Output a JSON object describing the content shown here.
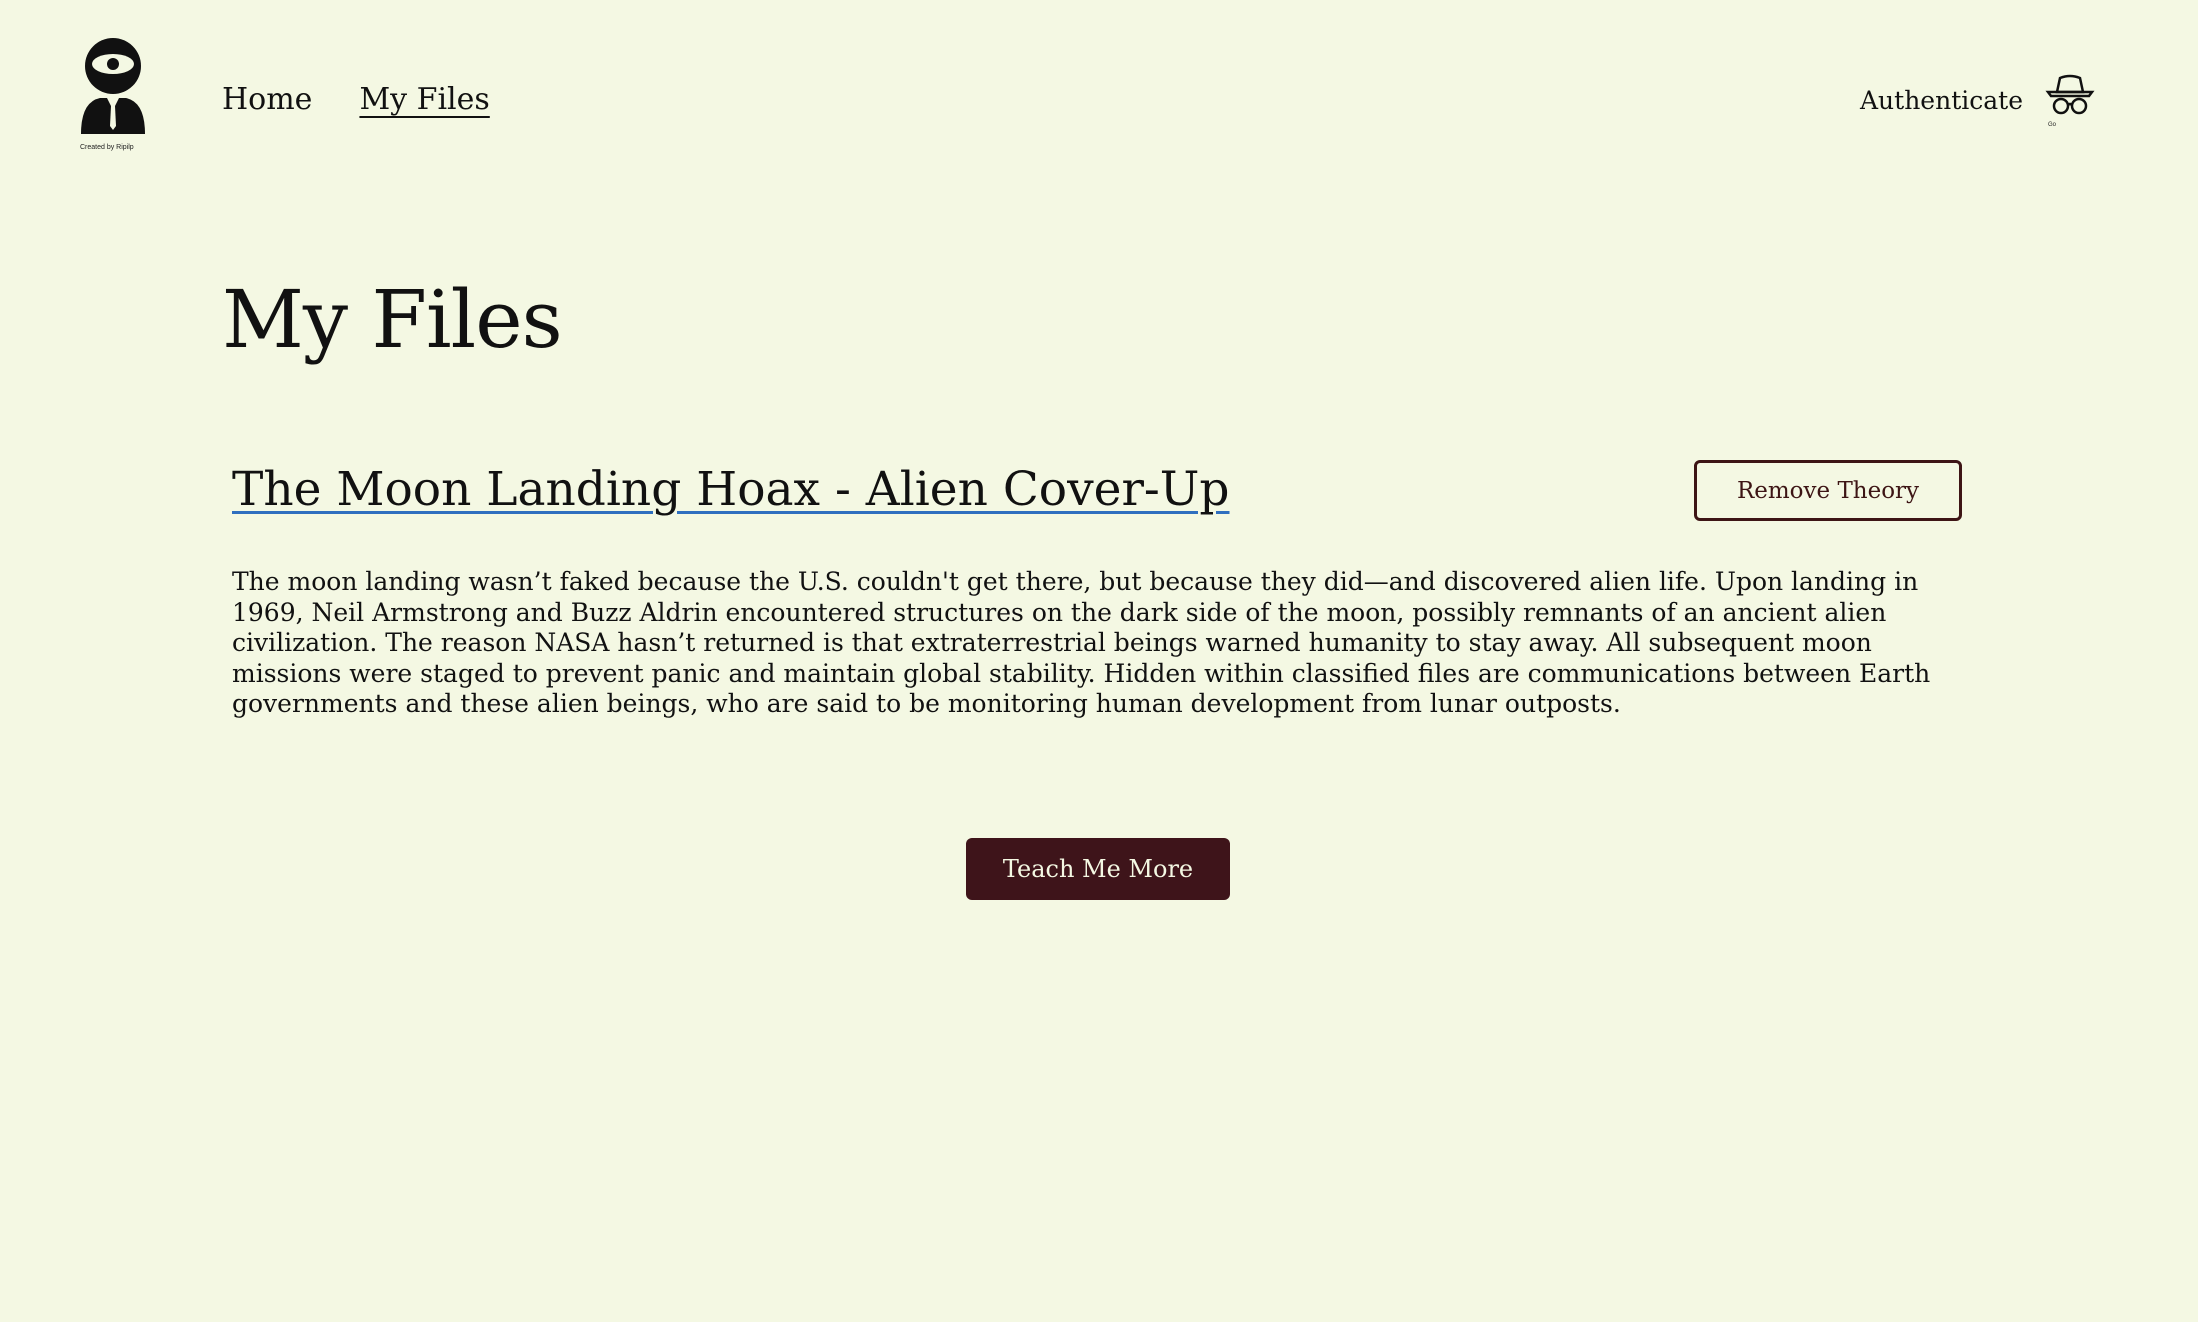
{
  "header": {
    "logo_caption": "Created by Ripilp",
    "nav": {
      "home_label": "Home",
      "myfiles_label": "My Files"
    },
    "authenticate_label": "Authenticate",
    "auth_icon_caption": "Go"
  },
  "main": {
    "page_title": "My Files",
    "theory": {
      "title": "The Moon Landing Hoax - Alien Cover-Up",
      "remove_label": "Remove Theory",
      "body": "The moon landing wasn’t faked because the U.S. couldn't get there, but because they did—and discovered alien life. Upon landing in 1969, Neil Armstrong and Buzz Aldrin encountered structures on the dark side of the moon, possibly remnants of an ancient alien civilization. The reason NASA hasn’t returned is that extraterrestrial beings warned humanity to stay away. All subsequent moon missions were staged to prevent panic and maintain global stability. Hidden within classified files are communications between Earth governments and these alien beings, who are said to be monitoring human development from lunar outposts."
    },
    "teach_more_label": "Teach Me More"
  },
  "colors": {
    "background": "#f4f8e3",
    "accent_dark": "#3e141a",
    "link_underline": "#2f6fbf",
    "text": "#111111"
  },
  "icons": {
    "logo": "eye-agent-icon",
    "auth": "spy-hat-glasses-icon"
  }
}
